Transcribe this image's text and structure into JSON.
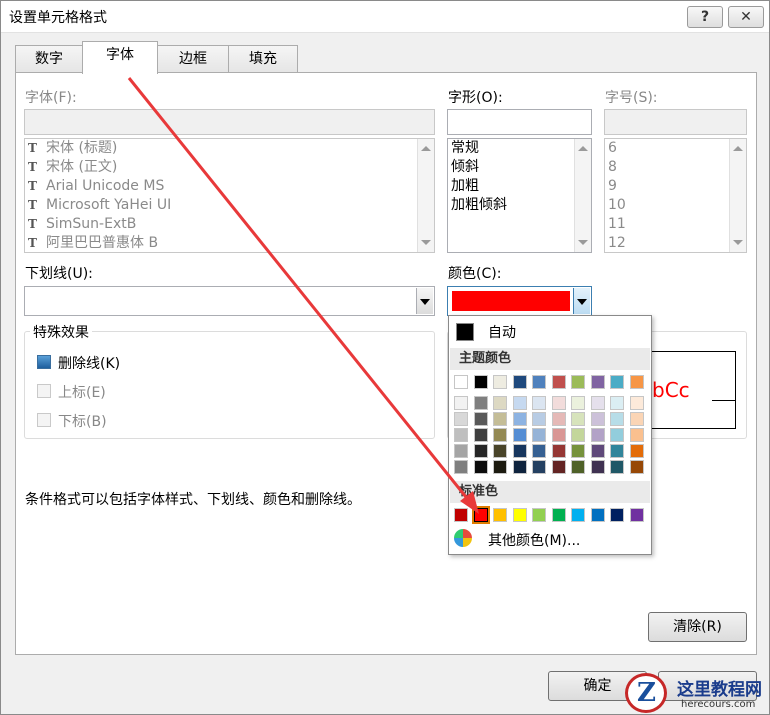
{
  "window": {
    "title": "设置单元格格式",
    "help_label": "?",
    "close_label": "✕"
  },
  "tabs": [
    "数字",
    "字体",
    "边框",
    "填充"
  ],
  "font": {
    "label": "字体(F):",
    "items": [
      "宋体 (标题)",
      "宋体 (正文)",
      "Arial Unicode MS",
      "Microsoft YaHei UI",
      "SimSun-ExtB",
      "阿里巴巴普惠体 B"
    ],
    "icon": "truetype-icon"
  },
  "style": {
    "label": "字形(O):",
    "items": [
      "常规",
      "倾斜",
      "加粗",
      "加粗倾斜"
    ]
  },
  "size": {
    "label": "字号(S):",
    "items": [
      "6",
      "8",
      "9",
      "10",
      "11",
      "12"
    ]
  },
  "underline": {
    "label": "下划线(U):",
    "value": ""
  },
  "color": {
    "label": "颜色(C):",
    "value": "#ff0000"
  },
  "effects": {
    "title": "特殊效果",
    "strikethrough": "删除线(K)",
    "superscript": "上标(E)",
    "subscript": "下标(B)"
  },
  "note": "条件格式可以包括字体样式、下划线、颜色和删除线。",
  "preview_text": "bCc",
  "buttons": {
    "clear": "清除(R)",
    "ok": "确定"
  },
  "palette": {
    "auto_label": "自动",
    "theme_label": "主题颜色",
    "standard_label": "标准色",
    "more_label": "其他颜色(M)...",
    "theme_top": [
      "#ffffff",
      "#000000",
      "#eeece1",
      "#1f497d",
      "#4f81bd",
      "#c0504d",
      "#9bbb59",
      "#8064a2",
      "#4bacc6",
      "#f79646"
    ],
    "theme_shades": [
      [
        "#f2f2f2",
        "#7f7f7f",
        "#ddd9c3",
        "#c6d9f0",
        "#dbe5f1",
        "#f2dcdb",
        "#ebf1dd",
        "#e5e0ec",
        "#dbeef3",
        "#fdeada"
      ],
      [
        "#d8d8d8",
        "#595959",
        "#c4bd97",
        "#8db3e2",
        "#b8cce4",
        "#e5b9b7",
        "#d7e3bc",
        "#ccc1d9",
        "#b7dde8",
        "#fbd5b5"
      ],
      [
        "#bfbfbf",
        "#3f3f3f",
        "#938953",
        "#548dd4",
        "#95b3d7",
        "#d99694",
        "#c3d69b",
        "#b2a2c7",
        "#92cddc",
        "#fac08f"
      ],
      [
        "#a5a5a5",
        "#262626",
        "#494429",
        "#17365d",
        "#366092",
        "#953734",
        "#76923c",
        "#5f497a",
        "#31859b",
        "#e36c09"
      ],
      [
        "#7f7f7f",
        "#0c0c0c",
        "#1d1b10",
        "#0f243e",
        "#244061",
        "#632423",
        "#4f6128",
        "#3f3151",
        "#205867",
        "#974806"
      ]
    ],
    "standard": [
      "#c00000",
      "#ff0000",
      "#ffc000",
      "#ffff00",
      "#92d050",
      "#00b050",
      "#00b0f0",
      "#0070c0",
      "#002060",
      "#7030a0"
    ],
    "selected_standard_index": 1
  },
  "watermark": {
    "brand": "这里教程网",
    "domain": "herecours.com",
    "letter": "Z"
  }
}
